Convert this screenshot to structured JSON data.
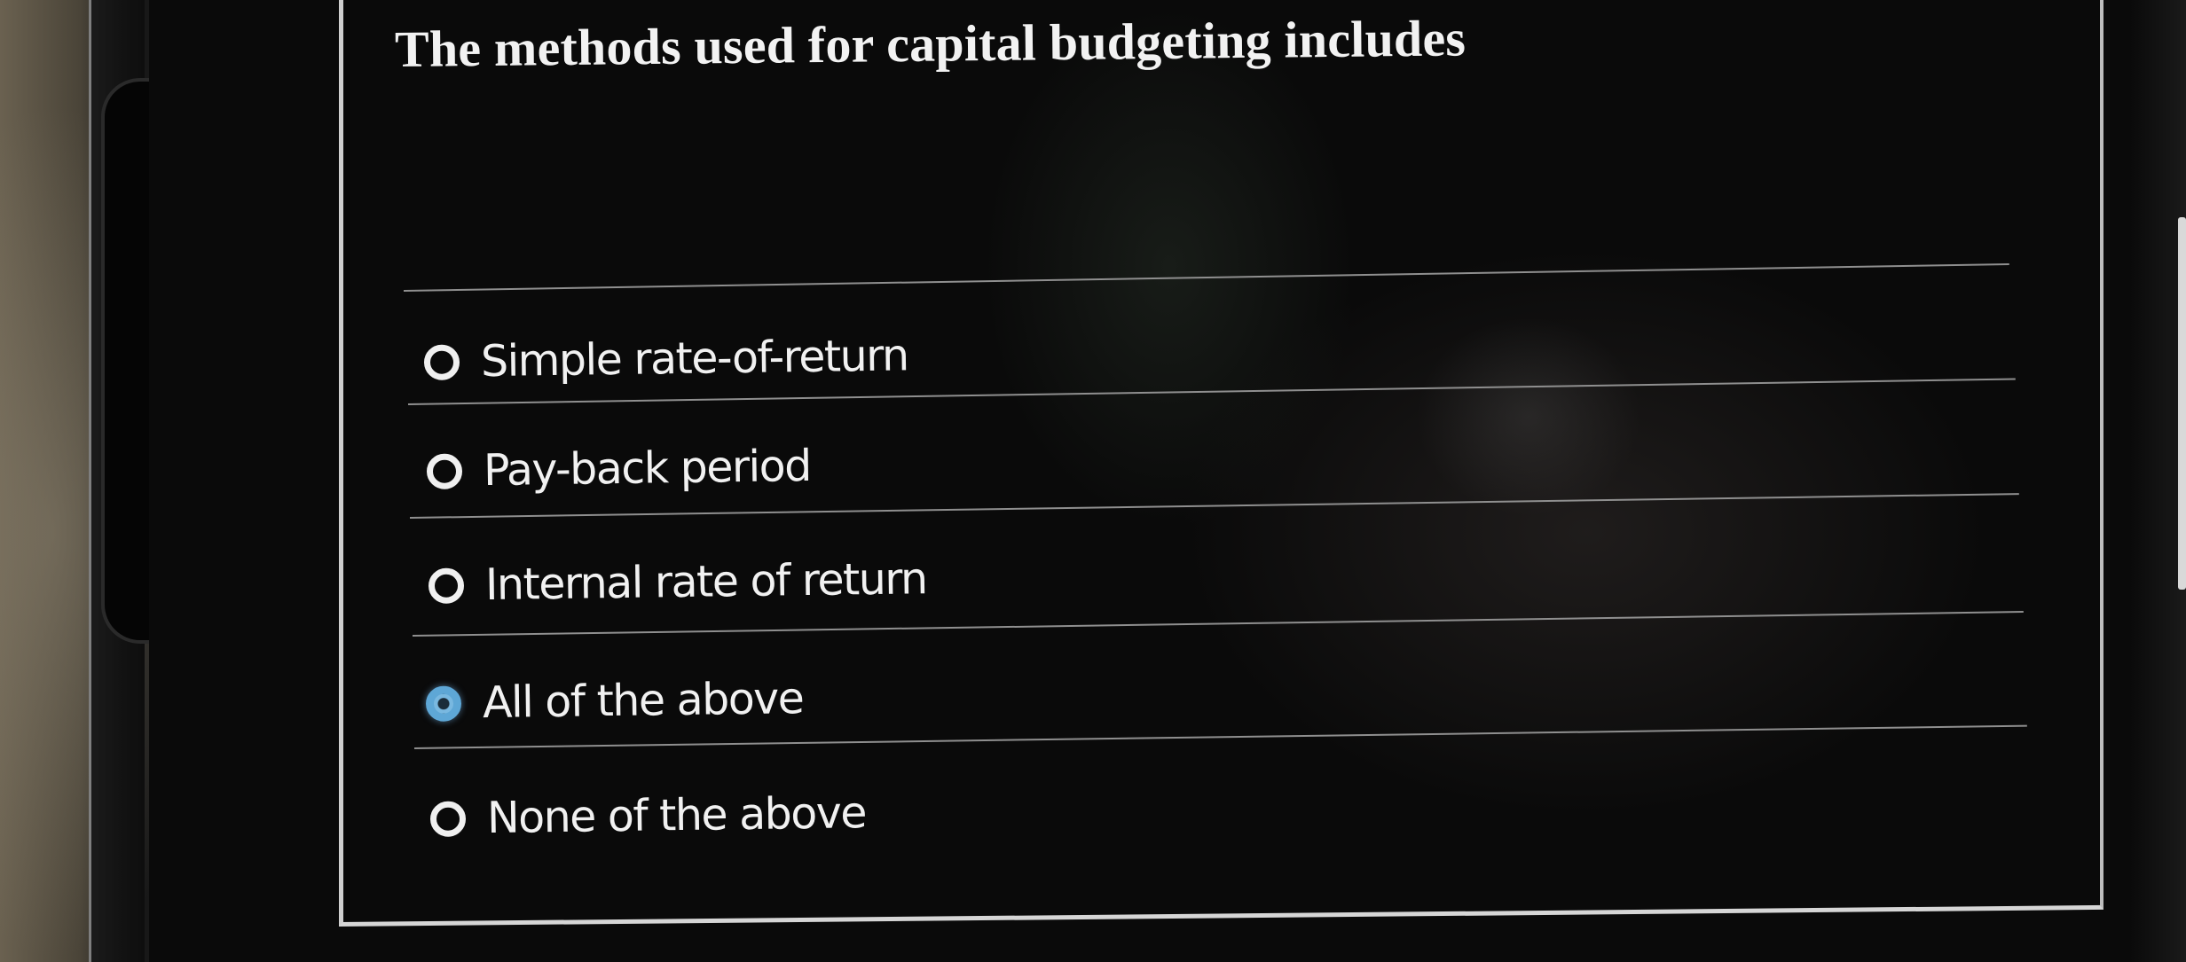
{
  "question": {
    "title": "The methods used for capital budgeting includes"
  },
  "options": [
    {
      "label": "Simple rate-of-return",
      "selected": false
    },
    {
      "label": "Pay-back period",
      "selected": false
    },
    {
      "label": "Internal rate of return",
      "selected": false
    },
    {
      "label": "All of the above",
      "selected": true
    },
    {
      "label": "None of the above",
      "selected": false
    }
  ],
  "colors": {
    "background": "#0a0a0a",
    "text": "#f1f1f1",
    "radio_selected": "#5ea7d6",
    "panel_border": "#cfcfcf"
  }
}
